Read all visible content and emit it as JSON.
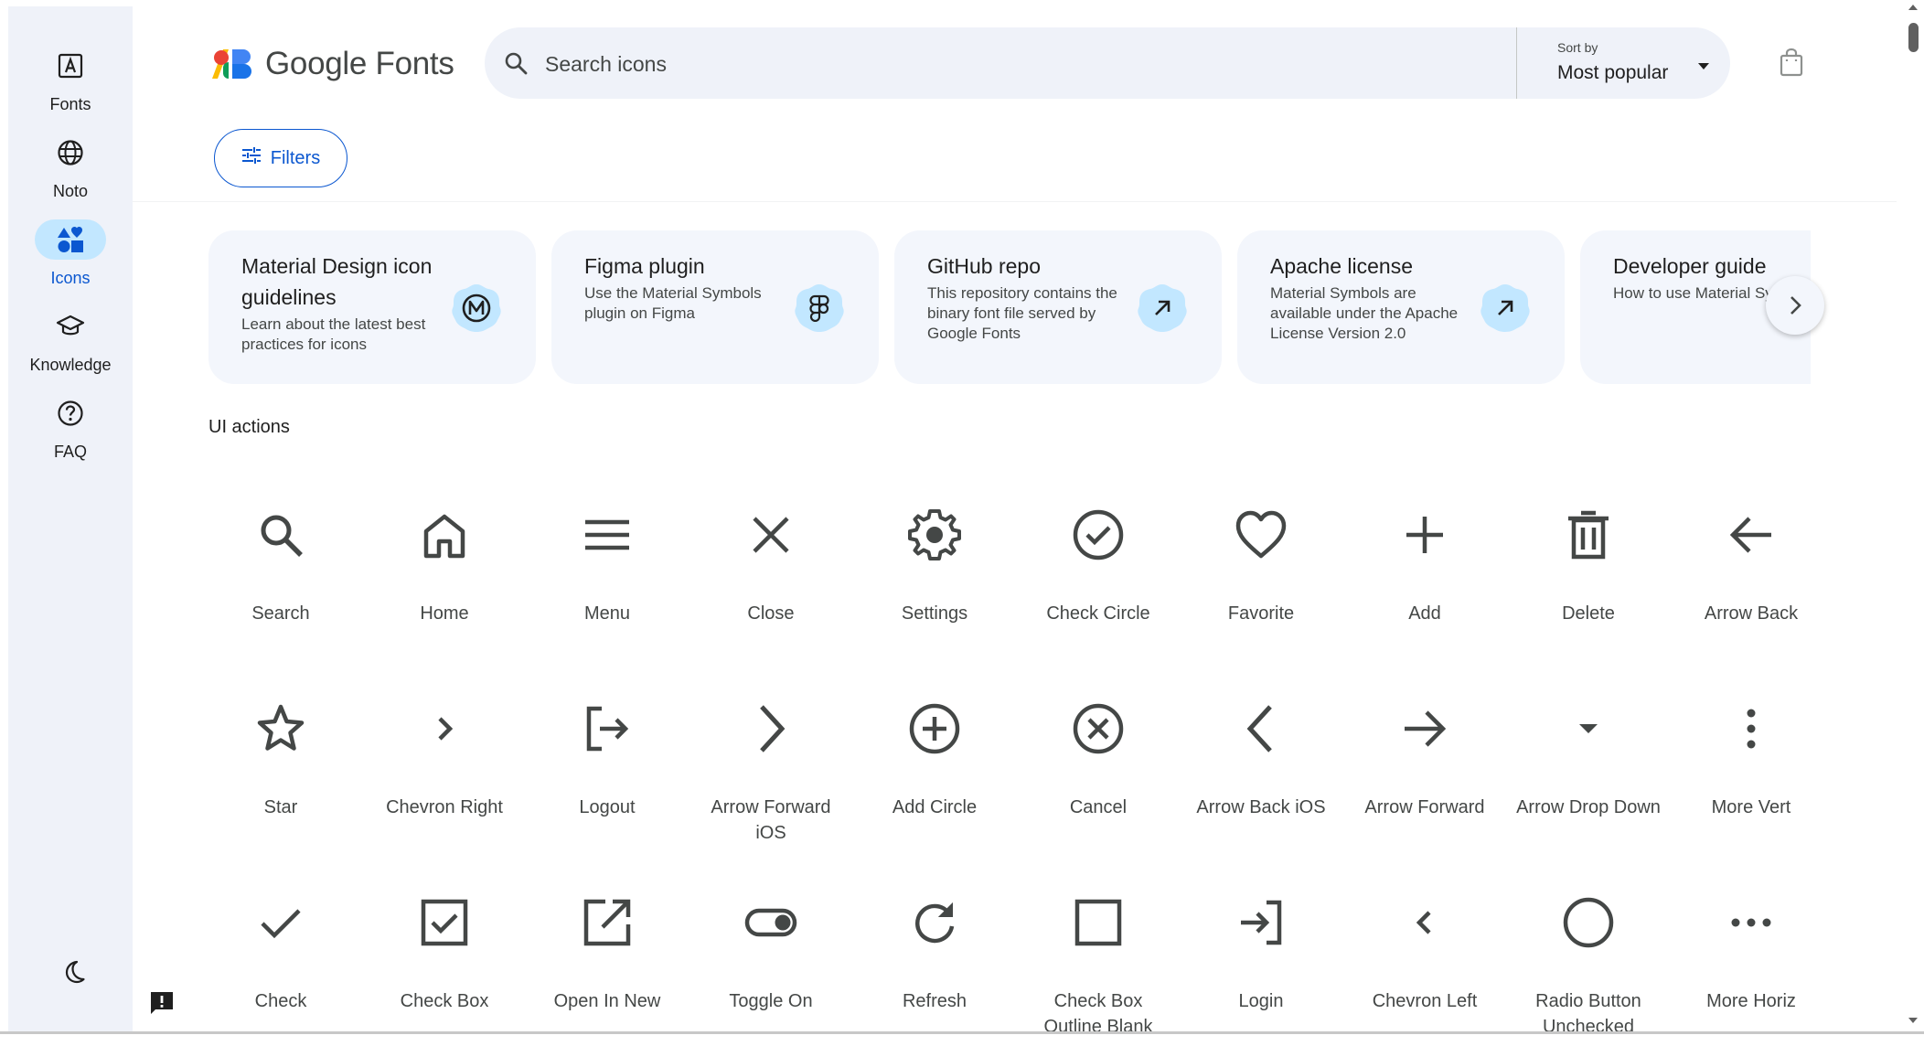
{
  "rail": {
    "items": [
      {
        "label": "Fonts",
        "icon": "fonts-icon",
        "active": false
      },
      {
        "label": "Noto",
        "icon": "globe-icon",
        "active": false
      },
      {
        "label": "Icons",
        "icon": "shapes-icon",
        "active": true
      },
      {
        "label": "Knowledge",
        "icon": "graduation-cap-icon",
        "active": false
      },
      {
        "label": "FAQ",
        "icon": "help-circle-icon",
        "active": false
      }
    ],
    "theme_icon": "dark-mode-icon",
    "feedback_icon": "feedback-icon"
  },
  "header": {
    "logo_text": "Google Fonts",
    "search_placeholder": "Search icons",
    "sort_label": "Sort by",
    "sort_value": "Most popular",
    "bag_icon": "shopping-bag-icon"
  },
  "filters": {
    "label": "Filters",
    "icon": "tune-icon"
  },
  "cards": [
    {
      "title": "Material Design icon guidelines",
      "desc": "Learn about the latest best practices for icons",
      "icon": "material-logo-icon"
    },
    {
      "title": "Figma plugin",
      "desc": "Use the Material Symbols plugin on Figma",
      "icon": "figma-icon"
    },
    {
      "title": "GitHub repo",
      "desc": "This repository contains the binary font file served by Google Fonts",
      "icon": "arrow-outward-icon"
    },
    {
      "title": "Apache license",
      "desc": "Material Symbols are available under the Apache License Version 2.0",
      "icon": "arrow-outward-icon"
    },
    {
      "title": "Developer guide",
      "desc": "How to use Material Symbols in your proj",
      "icon": "arrow-outward-icon"
    }
  ],
  "next_icon": "chevron-right-icon",
  "section_title": "UI actions",
  "icons": [
    {
      "label": "Search",
      "icon": "search"
    },
    {
      "label": "Home",
      "icon": "home"
    },
    {
      "label": "Menu",
      "icon": "menu"
    },
    {
      "label": "Close",
      "icon": "close"
    },
    {
      "label": "Settings",
      "icon": "settings"
    },
    {
      "label": "Check Circle",
      "icon": "check-circle"
    },
    {
      "label": "Favorite",
      "icon": "favorite"
    },
    {
      "label": "Add",
      "icon": "add"
    },
    {
      "label": "Delete",
      "icon": "delete"
    },
    {
      "label": "Arrow Back",
      "icon": "arrow-back"
    },
    {
      "label": "Star",
      "icon": "star"
    },
    {
      "label": "Chevron Right",
      "icon": "chevron-right"
    },
    {
      "label": "Logout",
      "icon": "logout"
    },
    {
      "label": "Arrow Forward iOS",
      "icon": "arrow-forward-ios"
    },
    {
      "label": "Add Circle",
      "icon": "add-circle"
    },
    {
      "label": "Cancel",
      "icon": "cancel"
    },
    {
      "label": "Arrow Back iOS",
      "icon": "arrow-back-ios"
    },
    {
      "label": "Arrow Forward",
      "icon": "arrow-forward"
    },
    {
      "label": "Arrow Drop Down",
      "icon": "arrow-drop-down"
    },
    {
      "label": "More Vert",
      "icon": "more-vert"
    },
    {
      "label": "Check",
      "icon": "check"
    },
    {
      "label": "Check Box",
      "icon": "check-box"
    },
    {
      "label": "Open In New",
      "icon": "open-in-new"
    },
    {
      "label": "Toggle On",
      "icon": "toggle-on"
    },
    {
      "label": "Refresh",
      "icon": "refresh"
    },
    {
      "label": "Check Box Outline Blank",
      "icon": "check-box-outline-blank"
    },
    {
      "label": "Login",
      "icon": "login"
    },
    {
      "label": "Chevron Left",
      "icon": "chevron-left"
    },
    {
      "label": "Radio Button Unchecked",
      "icon": "radio-button-unchecked"
    },
    {
      "label": "More Horiz",
      "icon": "more-horiz"
    }
  ],
  "colors": {
    "rail_bg": "#eff2f9",
    "accent": "#0b57d0",
    "active_pill": "#c2e7ff",
    "card_bg": "#f3f6fc",
    "icon_blob": "#c2e7ff",
    "icon_color": "#444746"
  }
}
